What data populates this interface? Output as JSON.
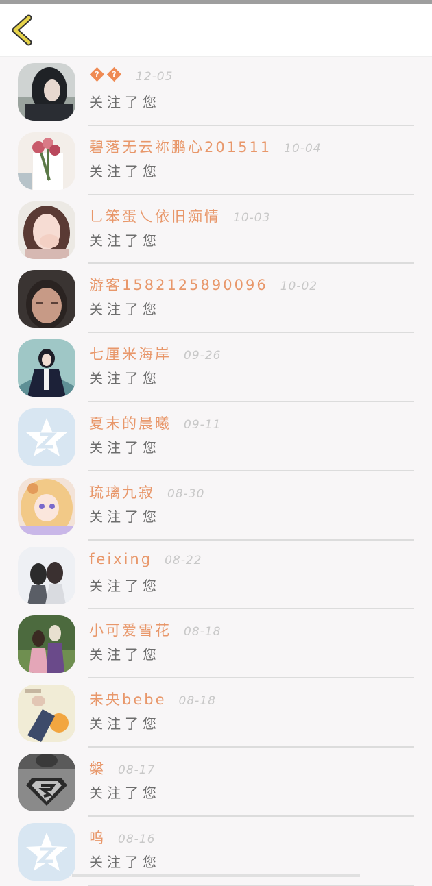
{
  "header": {
    "back_icon": "chevron-left-icon",
    "accent": "#e6d34a"
  },
  "colors": {
    "name": "#e8976a",
    "date": "#c8c8c8",
    "action": "#6d6d6d",
    "divider": "#dcdcdc"
  },
  "followers": [
    {
      "name": "",
      "name_glyphs": [
        "?",
        "?"
      ],
      "date": "12-05",
      "action": "关注了您",
      "avatar": "photo-dark-hair"
    },
    {
      "name": "碧落无云祢鹏心201511",
      "date": "10-04",
      "action": "关注了您",
      "avatar": "photo-flowers"
    },
    {
      "name": "乚笨蛋乀依旧痴情",
      "date": "10-03",
      "action": "关注了您",
      "avatar": "photo-girl"
    },
    {
      "name": "游客1582125890096",
      "date": "10-02",
      "action": "关注了您",
      "avatar": "photo-face"
    },
    {
      "name": "七厘米海岸",
      "date": "09-26",
      "action": "关注了您",
      "avatar": "photo-dark-dress"
    },
    {
      "name": "夏末的晨曦",
      "date": "09-11",
      "action": "关注了您",
      "avatar": "default-qq-star"
    },
    {
      "name": "琉璃九寂",
      "date": "08-30",
      "action": "关注了您",
      "avatar": "anime-girl"
    },
    {
      "name": "feixing",
      "date": "08-22",
      "action": "关注了您",
      "avatar": "photo-two-girls"
    },
    {
      "name": "小可爱雪花",
      "date": "08-18",
      "action": "关注了您",
      "avatar": "photo-couple"
    },
    {
      "name": "未央bebe",
      "date": "08-18",
      "action": "关注了您",
      "avatar": "illustration-cat"
    },
    {
      "name": "槃",
      "date": "08-17",
      "action": "关注了您",
      "avatar": "photo-superman-shirt"
    },
    {
      "name": "呜",
      "date": "08-16",
      "action": "关注了您",
      "avatar": "default-qq-star"
    }
  ]
}
